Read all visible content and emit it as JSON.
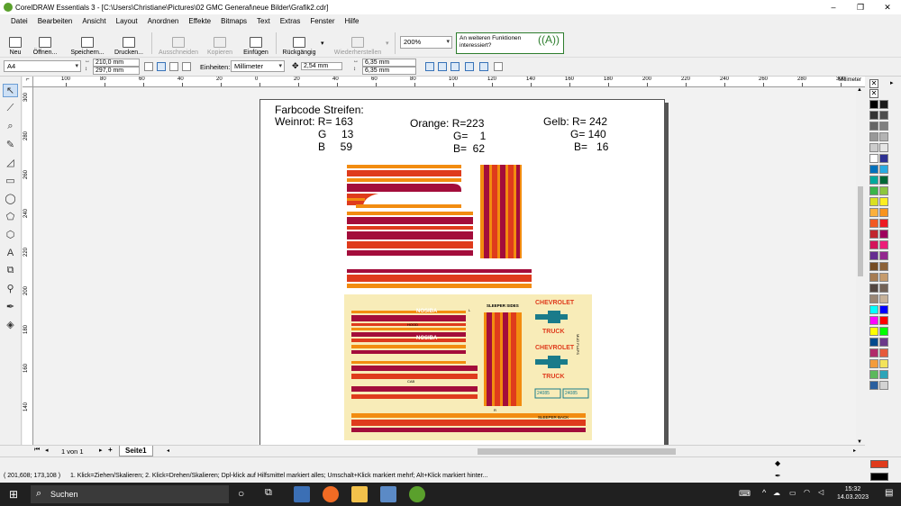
{
  "window": {
    "title": "CorelDRAW Essentials 3 - [C:\\Users\\Christiane\\Pictures\\02 GMC General\\neue Bilder\\Grafik2.cdr]",
    "minimize": "–",
    "maximize": "❐",
    "close": "✕"
  },
  "menu": [
    "Datei",
    "Bearbeiten",
    "Ansicht",
    "Layout",
    "Anordnen",
    "Effekte",
    "Bitmaps",
    "Text",
    "Extras",
    "Fenster",
    "Hilfe"
  ],
  "toolbar": {
    "new": "Neu",
    "open": "Öffnen...",
    "save": "Speichern...",
    "print": "Drucken...",
    "cut": "Ausschneiden",
    "copy": "Kopieren",
    "paste": "Einfügen",
    "undo": "Rückgängig",
    "redo": "Wiederherstellen",
    "zoom": "200%",
    "hint": "An weiteren Funktionen interessiert?"
  },
  "propertybar": {
    "page_size": "A4",
    "width": "210,0 mm",
    "height": "297,0 mm",
    "units_label": "Einheiten:",
    "units": "Millimeter",
    "nudge": "2,54 mm",
    "dup_x": "6,35 mm",
    "dup_y": "6,35 mm"
  },
  "ruler": {
    "h_ticks": [
      "100",
      "80",
      "60",
      "40",
      "20",
      "0",
      "20",
      "40",
      "60",
      "80",
      "100",
      "120",
      "140",
      "160",
      "180",
      "200",
      "220",
      "240",
      "260",
      "280",
      "300",
      "320"
    ],
    "h_unit": "Millimeter",
    "v_ticks": [
      "300",
      "280",
      "260",
      "240",
      "220",
      "200",
      "180",
      "160",
      "140"
    ],
    "v_unit": "Millimeter"
  },
  "document": {
    "heading": "Farbcode Streifen:",
    "weinrot": [
      "Weinrot: R= 163",
      "G     13",
      "B     59"
    ],
    "orange": [
      "Orange: R=223",
      "G=    1",
      "B=  62"
    ],
    "gelb": [
      "Gelb: R= 242",
      "G= 140",
      "B=   16"
    ],
    "decal": {
      "hood_logo": "NOSIBA",
      "hood_logo2": "NOSIBA",
      "hood_label": "HOOD",
      "cab_label": "CAB",
      "sleeper_sides": "SLEEPER SIDES",
      "chevrolet": "CHEVROLET",
      "truck": "TRUCK",
      "mud_flaps": "MUD FLAPS",
      "plate1": "24085",
      "plate2": "24085",
      "sleeper_back": "SLEEPER BACK",
      "l": "L",
      "r": "R",
      "colors": {
        "weinrot": "#a30d3b",
        "orange": "#df3b1c",
        "gelb": "#f28c10",
        "background": "#f8ecb8",
        "chevy_blue": "#1a7b8a"
      }
    }
  },
  "pages": {
    "counter": "1 von 1",
    "tab": "Seite1"
  },
  "status": {
    "coords": "( 201,608; 173,108 )",
    "hint": "1. Klick=Ziehen/Skalieren; 2. Klick=Drehen/Skalieren; Dpl-klick auf Hilfsmittel markiert alles; Umschalt+Klick markiert mehrf; Alt+Klick markiert hinter..."
  },
  "taskbar": {
    "search": "Suchen",
    "time": "15:32",
    "date": "14.03.2023"
  },
  "palette": [
    "#000000",
    "#1a1a1a",
    "#333333",
    "#4d4d4d",
    "#666666",
    "#808080",
    "#999999",
    "#b3b3b3",
    "#cccccc",
    "#e6e6e6",
    "#ffffff",
    "#2e3192",
    "#0071bc",
    "#29abe2",
    "#00a99d",
    "#006837",
    "#39b54a",
    "#8cc63f",
    "#d9e021",
    "#fcee21",
    "#fbb03b",
    "#f7931e",
    "#f15a24",
    "#ed1c24",
    "#c1272d",
    "#9e005d",
    "#d4145a",
    "#ed1e79",
    "#662d91",
    "#93278f",
    "#754c24",
    "#8c6239",
    "#a67c52",
    "#c69c6d",
    "#534741",
    "#736357",
    "#998675",
    "#c7b299",
    "#00ffff",
    "#0000ff",
    "#ff00ff",
    "#ff0000",
    "#ffff00",
    "#00ff00",
    "#004b8d",
    "#6b3a8a",
    "#b12a6a",
    "#e65b3c",
    "#f49c3c",
    "#f3e35a",
    "#5cb85c",
    "#2ea4b8",
    "#2a5f9e",
    "#d3d3d3"
  ]
}
